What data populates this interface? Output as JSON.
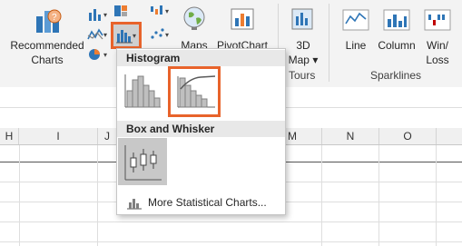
{
  "ribbon": {
    "recommended_charts_line1": "Recommended",
    "recommended_charts_line2": "Charts",
    "maps_label": "Maps",
    "pivotchart_label": "PivotChart",
    "map3d_line1": "3D",
    "map3d_line2": "Map",
    "tours_label": "Tours",
    "sparkline_line": "Line",
    "sparkline_column": "Column",
    "sparkline_winloss_line1": "Win/",
    "sparkline_winloss_line2": "Loss",
    "sparklines_group": "Sparklines"
  },
  "dropdown": {
    "histogram_header": "Histogram",
    "box_whisker_header": "Box and Whisker",
    "more_link": "More Statistical Charts..."
  },
  "columns": [
    "H",
    "I",
    "J",
    "M",
    "N",
    "O"
  ],
  "colors": {
    "highlight": "#e8632b",
    "accent_blue": "#2e75b6",
    "ribbon_bg": "#f3f3f3"
  },
  "icons": {
    "statistic_chart": "statistic-chart-icon",
    "histogram": "histogram-icon",
    "pareto": "pareto-icon",
    "box_whisker": "box-whisker-icon"
  }
}
